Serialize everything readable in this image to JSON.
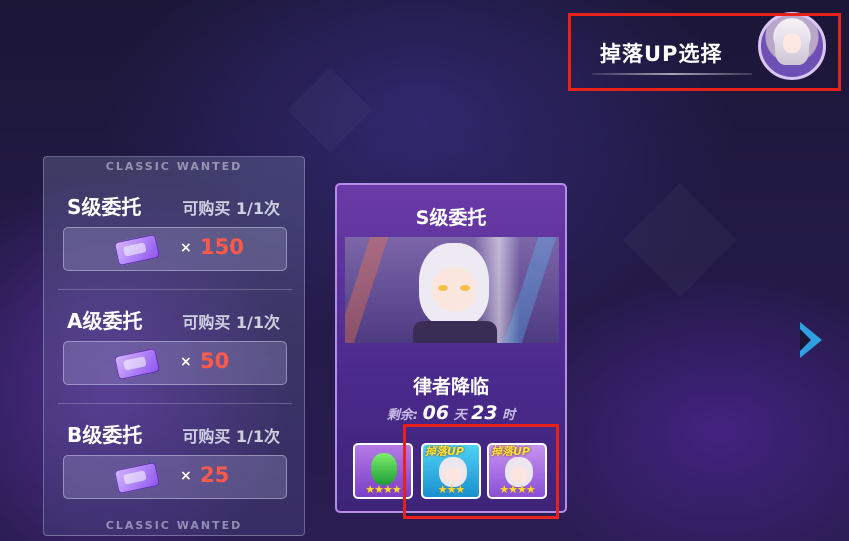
{
  "drop_select": {
    "label": "掉落UP选择",
    "avatar_icon": "character-avatar"
  },
  "left_panel": {
    "header": "CLASSIC WANTED",
    "footer": "CLASSIC WANTED",
    "tasks": [
      {
        "title": "S级委托",
        "limit": "可购买 1/1次",
        "x": "×",
        "price": "150"
      },
      {
        "title": "A级委托",
        "limit": "可购买 1/1次",
        "x": "×",
        "price": "50"
      },
      {
        "title": "B级委托",
        "limit": "可购买 1/1次",
        "x": "×",
        "price": "25"
      }
    ]
  },
  "card": {
    "title": "S级委托",
    "name": "律者降临",
    "remain_label": "剩余:",
    "days": "06",
    "days_unit": "天",
    "hours": "23",
    "hours_unit": "时",
    "rewards": [
      {
        "type": "gem-icon",
        "stars": "★★★★",
        "up": ""
      },
      {
        "type": "character-fragment-icon",
        "stars": "★★★",
        "up": "掉落UP"
      },
      {
        "type": "character-fragment-icon",
        "stars": "★★★★",
        "up": "掉落UP"
      }
    ]
  },
  "colors": {
    "price": "#ff5a4a",
    "highlight_box": "#e8211b",
    "arrow": "#2f9fe0",
    "up_text": "#ffe23b"
  }
}
